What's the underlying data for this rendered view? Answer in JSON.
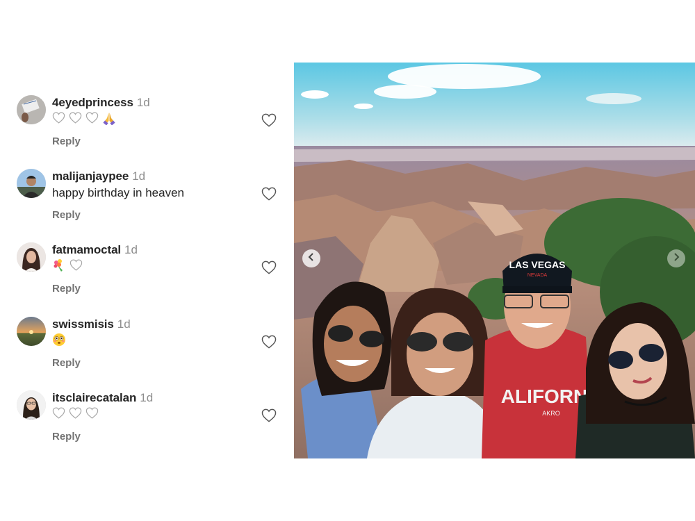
{
  "comments": [
    {
      "username": "4eyedprincess",
      "time": "1d",
      "text": "",
      "emojis": [
        "heart-outline",
        "heart-outline",
        "heart-outline",
        "praying-hands"
      ],
      "reply": "Reply"
    },
    {
      "username": "malijanjaypee",
      "time": "1d",
      "text": "happy birthday in heaven",
      "emojis": [],
      "reply": "Reply"
    },
    {
      "username": "fatmamoctal",
      "time": "1d",
      "text": "",
      "emojis": [
        "bouquet",
        "heart-outline"
      ],
      "reply": "Reply"
    },
    {
      "username": "swissmisis",
      "time": "1d",
      "text": "",
      "emojis": [
        "flushed-face"
      ],
      "reply": "Reply"
    },
    {
      "username": "itsclairecatalan",
      "time": "1d",
      "text": "",
      "emojis": [
        "heart-outline",
        "heart-outline",
        "heart-outline"
      ],
      "reply": "Reply"
    }
  ],
  "photo": {
    "cap_text": "LAS VEGAS",
    "cap_sub": "NEVADA",
    "shirt_text": "ALIFORN",
    "shirt_sub": "AKRO"
  },
  "colors": {
    "username": "#262626",
    "muted": "#8e8e8e",
    "reply": "#737373",
    "sky": "#7fd1e6"
  }
}
